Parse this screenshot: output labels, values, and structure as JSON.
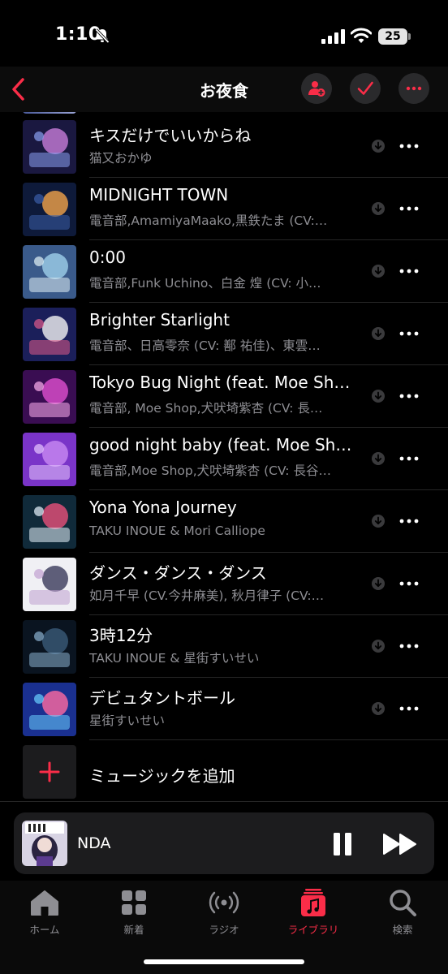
{
  "status": {
    "time": "1:10",
    "battery": "25"
  },
  "nav": {
    "title": "お夜食"
  },
  "songs": [
    {
      "title": "キスだけでいいからね",
      "artist": "猫又おかゆ"
    },
    {
      "title": "MIDNIGHT TOWN",
      "artist": "電音部,AmamiyaMaako,黒鉄たま (CV:…"
    },
    {
      "title": "0:00",
      "artist": "電音部,Funk Uchino、白金 煌 (CV: 小…"
    },
    {
      "title": "Brighter Starlight",
      "artist": "電音部、日高零奈 (CV: 鄯 祐佳)、東雲…"
    },
    {
      "title": "Tokyo Bug Night (feat. Moe Sh…",
      "artist": "電音部, Moe Shop,犬吠埼紫杏 (CV: 長…"
    },
    {
      "title": "good night baby (feat. Moe Sh…",
      "artist": "電音部,Moe Shop,犬吠埼紫杏 (CV: 長谷…"
    },
    {
      "title": "Yona Yona Journey",
      "artist": "TAKU INOUE & Mori Calliope"
    },
    {
      "title": "ダンス・ダンス・ダンス",
      "artist": "如月千早 (CV.今井麻美), 秋月律子 (CV:…"
    },
    {
      "title": "3時12分",
      "artist": "TAKU INOUE & 星街すいせい"
    },
    {
      "title": "デビュタントボール",
      "artist": "星街すいせい"
    }
  ],
  "add_music": {
    "label": "ミュージックを追加"
  },
  "now_playing": {
    "title": "NDA"
  },
  "tabs": [
    {
      "label": "ホーム",
      "icon": "home-icon"
    },
    {
      "label": "新着",
      "icon": "grid-icon"
    },
    {
      "label": "ラジオ",
      "icon": "radio-icon"
    },
    {
      "label": "ライブラリ",
      "icon": "library-icon",
      "active": true
    },
    {
      "label": "検索",
      "icon": "search-icon"
    }
  ],
  "colors": {
    "accent": "#fa2d48",
    "background": "#000000",
    "secondary_text": "#8e8e93"
  }
}
